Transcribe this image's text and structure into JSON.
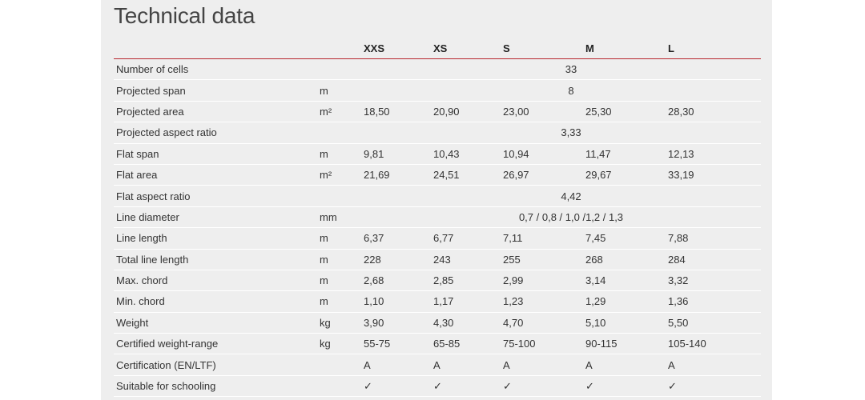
{
  "title": "Technical data",
  "headers": [
    "",
    "",
    "XXS",
    "XS",
    "S",
    "M",
    "L"
  ],
  "rows": [
    {
      "label": "Number of cells",
      "unit": "",
      "merged": "33"
    },
    {
      "label": "Projected span",
      "unit": "m",
      "merged": "8"
    },
    {
      "label": "Projected area",
      "unit": "m²",
      "values": [
        "18,50",
        "20,90",
        "23,00",
        "25,30",
        "28,30"
      ]
    },
    {
      "label": "Projected aspect ratio",
      "unit": "",
      "merged": "3,33"
    },
    {
      "label": "Flat span",
      "unit": "m",
      "values": [
        "9,81",
        "10,43",
        "10,94",
        "11,47",
        "12,13"
      ]
    },
    {
      "label": "Flat area",
      "unit": "m²",
      "values": [
        "21,69",
        "24,51",
        "26,97",
        "29,67",
        "33,19"
      ]
    },
    {
      "label": "Flat aspect ratio",
      "unit": "",
      "merged": "4,42"
    },
    {
      "label": "Line diameter",
      "unit": "mm",
      "merged": "0,7 / 0,8 / 1,0 /1,2 / 1,3"
    },
    {
      "label": "Line length",
      "unit": "m",
      "values": [
        "6,37",
        "6,77",
        "7,11",
        "7,45",
        "7,88"
      ]
    },
    {
      "label": "Total line length",
      "unit": "m",
      "values": [
        "228",
        "243",
        "255",
        "268",
        "284"
      ]
    },
    {
      "label": "Max. chord",
      "unit": "m",
      "values": [
        "2,68",
        "2,85",
        "2,99",
        "3,14",
        "3,32"
      ]
    },
    {
      "label": "Min. chord",
      "unit": "m",
      "values": [
        "1,10",
        "1,17",
        "1,23",
        "1,29",
        "1,36"
      ]
    },
    {
      "label": "Weight",
      "unit": "kg",
      "values": [
        "3,90",
        "4,30",
        "4,70",
        "5,10",
        "5,50"
      ]
    },
    {
      "label": "Certified weight-range",
      "unit": "kg",
      "values": [
        "55-75",
        "65-85",
        "75-100",
        "90-115",
        "105-140"
      ]
    },
    {
      "label": "Certification (EN/LTF)",
      "unit": "",
      "values": [
        "A",
        "A",
        "A",
        "A",
        "A"
      ]
    },
    {
      "label": "Suitable for schooling",
      "unit": "",
      "values": [
        "✓",
        "✓",
        "✓",
        "✓",
        "✓"
      ]
    }
  ],
  "colors": {
    "panel": "#eeeeee",
    "header_rule": "#b8262e",
    "row_divider": "#ffffff"
  }
}
